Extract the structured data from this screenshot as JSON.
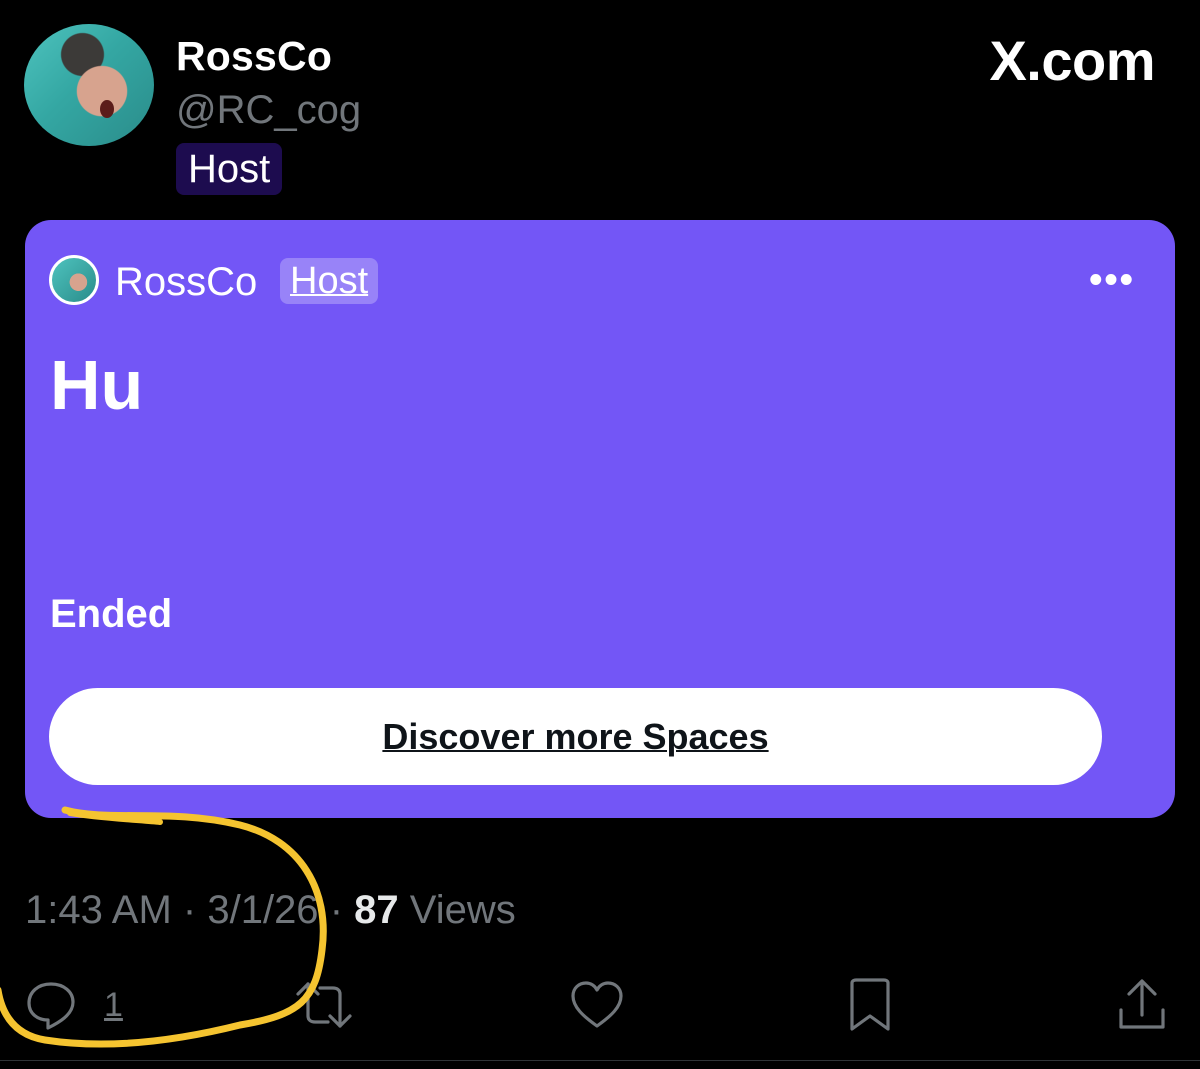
{
  "header": {
    "display_name": "RossCo",
    "handle": "@RC_cog",
    "role_badge": "Host",
    "brand": "X.com"
  },
  "space_card": {
    "host_name": "RossCo",
    "host_badge": "Host",
    "more_label": "•••",
    "title": "Hu",
    "status": "Ended",
    "discover_label": "Discover more Spaces",
    "background_color": "#7356f6"
  },
  "meta": {
    "time": "1:43 AM",
    "separator": "·",
    "date": "3/1/26",
    "views_count": "87",
    "views_label": "Views"
  },
  "actions": {
    "reply_count": "1",
    "icons": [
      "reply-icon",
      "repost-icon",
      "like-icon",
      "bookmark-icon",
      "share-icon"
    ]
  },
  "annotation": {
    "color": "#f5c430"
  }
}
